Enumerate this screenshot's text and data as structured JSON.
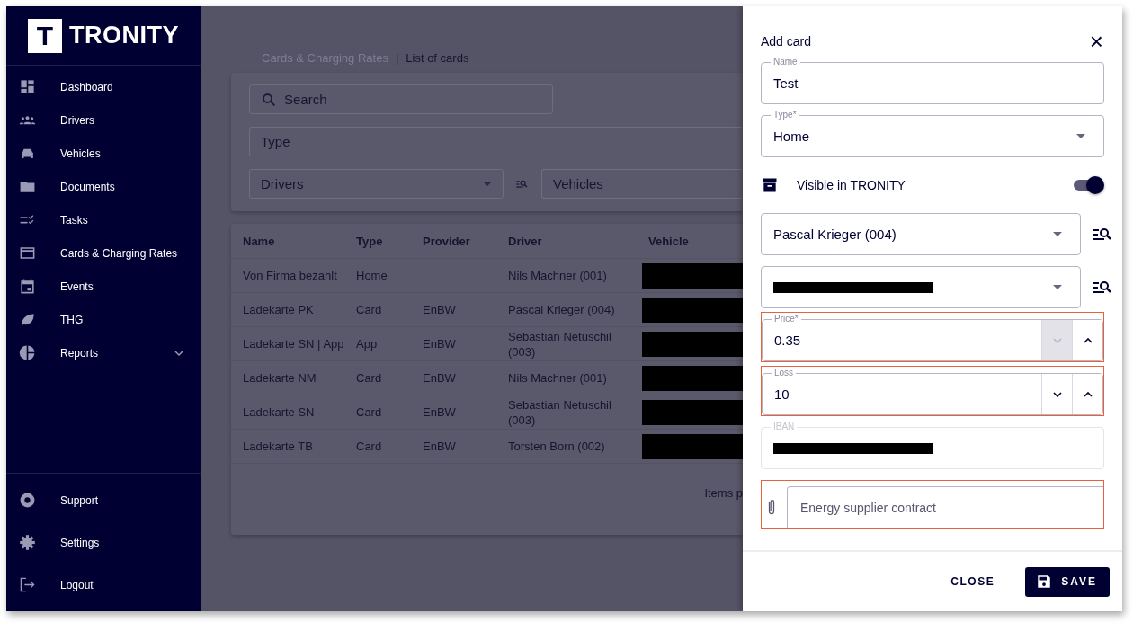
{
  "sidebar": {
    "brand": {
      "letter": "T",
      "name": "TRONITY"
    },
    "items": [
      {
        "label": "Dashboard"
      },
      {
        "label": "Drivers"
      },
      {
        "label": "Vehicles"
      },
      {
        "label": "Documents"
      },
      {
        "label": "Tasks"
      },
      {
        "label": "Cards & Charging Rates"
      },
      {
        "label": "Events"
      },
      {
        "label": "THG"
      },
      {
        "label": "Reports",
        "expandable": true
      }
    ],
    "bottom_items": [
      {
        "label": "Support"
      },
      {
        "label": "Settings"
      },
      {
        "label": "Logout"
      }
    ]
  },
  "breadcrumb": {
    "parent": "Cards & Charging Rates",
    "separator": "|",
    "current": "List of cards"
  },
  "filters": {
    "search": {
      "placeholder": "Search"
    },
    "type": {
      "placeholder": "Type"
    },
    "drivers": {
      "placeholder": "Drivers"
    },
    "vehicles": {
      "placeholder": "Vehicles"
    }
  },
  "table": {
    "columns": [
      "Name",
      "Type",
      "Provider",
      "Driver",
      "Vehicle"
    ],
    "rows": [
      {
        "name": "Von Firma bezahlt",
        "type": "Home",
        "driver": "Nils Machner (001)",
        "vehicle_redacted": true
      },
      {
        "name": "Ladekarte PK",
        "type": "Card",
        "provider": "EnBW",
        "driver": "Pascal Krieger (004)",
        "vehicle_redacted": true
      },
      {
        "name": "Ladekarte SN | App",
        "type": "App",
        "provider": "EnBW",
        "driver": "Sebastian Netuschil (003)",
        "vehicle_redacted": true
      },
      {
        "name": "Ladekarte NM",
        "type": "Card",
        "provider": "EnBW",
        "driver": "Nils Machner (001)",
        "vehicle_redacted": true
      },
      {
        "name": "Ladekarte SN",
        "type": "Card",
        "provider": "EnBW",
        "driver": "Sebastian Netuschil (003)",
        "vehicle_redacted": true
      },
      {
        "name": "Ladekarte TB",
        "type": "Card",
        "provider": "EnBW",
        "driver": "Torsten Born (002)",
        "vehicle_redacted": true
      }
    ],
    "footer": "Items p"
  },
  "drawer": {
    "title": "Add card",
    "close_symbol": "×",
    "name": {
      "label": "Name",
      "value": "Test"
    },
    "type": {
      "label": "Type*",
      "value": "Home"
    },
    "visible": {
      "label": "Visible in TRONITY",
      "on": true
    },
    "driver": {
      "value": "Pascal Krieger (004)"
    },
    "vehicle": {
      "redacted": true
    },
    "price": {
      "label": "Price*",
      "value": "0.35",
      "error": true,
      "down_disabled": true
    },
    "loss": {
      "label": "Loss",
      "value": "10",
      "error": true,
      "down_disabled": false
    },
    "iban": {
      "label": "IBAN",
      "redacted": true,
      "disabled": true
    },
    "attachment": {
      "placeholder": "Energy supplier contract",
      "error": true
    },
    "buttons": {
      "close": "CLOSE",
      "save": "SAVE"
    }
  }
}
